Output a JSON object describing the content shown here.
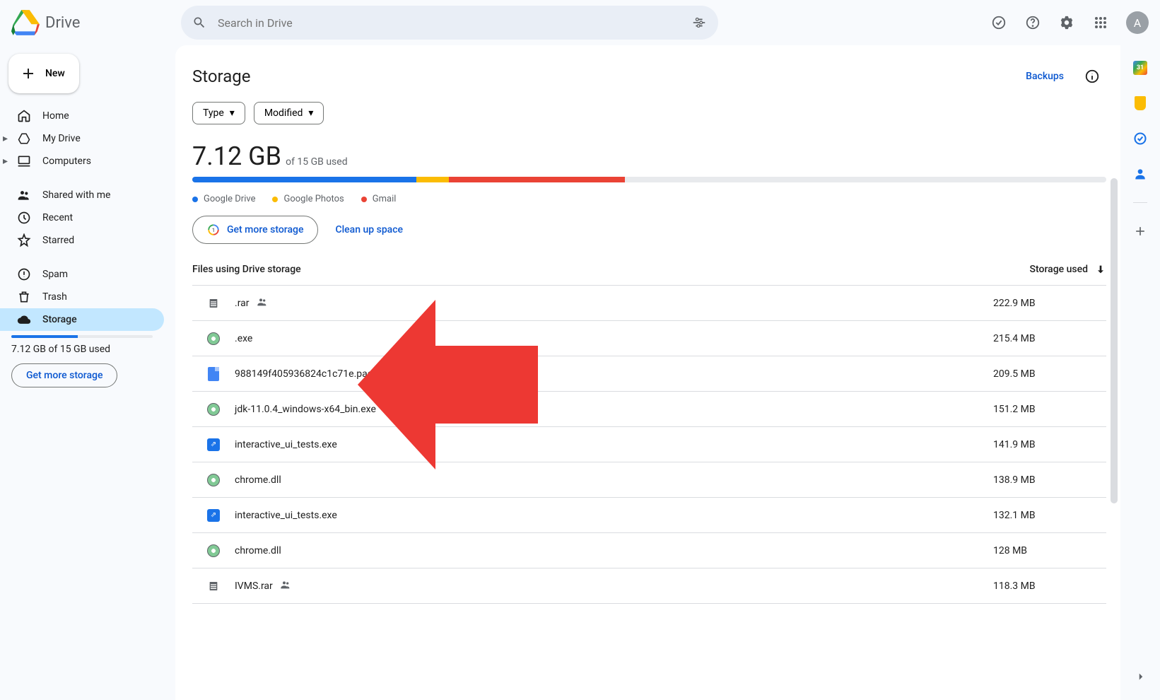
{
  "app": {
    "name": "Drive",
    "avatar_initial": "A"
  },
  "search": {
    "placeholder": "Search in Drive"
  },
  "new_button": "New",
  "nav": {
    "home": "Home",
    "mydrive": "My Drive",
    "computers": "Computers",
    "shared": "Shared with me",
    "recent": "Recent",
    "starred": "Starred",
    "spam": "Spam",
    "trash": "Trash",
    "storage": "Storage"
  },
  "sidebar_usage": "7.12 GB of 15 GB used",
  "sidebar_cta": "Get more storage",
  "page": {
    "title": "Storage",
    "backups": "Backups",
    "filters": {
      "type": "Type",
      "modified": "Modified"
    },
    "used_amount": "7.12 GB",
    "used_of": "of 15 GB used",
    "legend": {
      "drive": "Google Drive",
      "photos": "Google Photos",
      "gmail": "Gmail"
    },
    "get_more": "Get more storage",
    "clean_up": "Clean up space",
    "table": {
      "files_col": "Files using Drive storage",
      "size_col": "Storage used"
    }
  },
  "files": [
    {
      "name": ".rar",
      "size": "222.9 MB",
      "icon": "rar",
      "shared": true
    },
    {
      "name": ".exe",
      "size": "215.4 MB",
      "icon": "disc",
      "shared": false
    },
    {
      "name": "988149f405936824c1c71e.pack",
      "size": "209.5 MB",
      "icon": "doc",
      "shared": false
    },
    {
      "name": "jdk-11.0.4_windows-x64_bin.exe",
      "size": "151.2 MB",
      "icon": "disc",
      "shared": false
    },
    {
      "name": "interactive_ui_tests.exe",
      "size": "141.9 MB",
      "icon": "proj",
      "shared": false
    },
    {
      "name": "chrome.dll",
      "size": "138.9 MB",
      "icon": "disc",
      "shared": false
    },
    {
      "name": "interactive_ui_tests.exe",
      "size": "132.1 MB",
      "icon": "proj",
      "shared": false
    },
    {
      "name": "chrome.dll",
      "size": "128 MB",
      "icon": "disc",
      "shared": false
    },
    {
      "name": "IVMS.rar",
      "size": "118.3 MB",
      "icon": "rar",
      "shared": true
    }
  ]
}
